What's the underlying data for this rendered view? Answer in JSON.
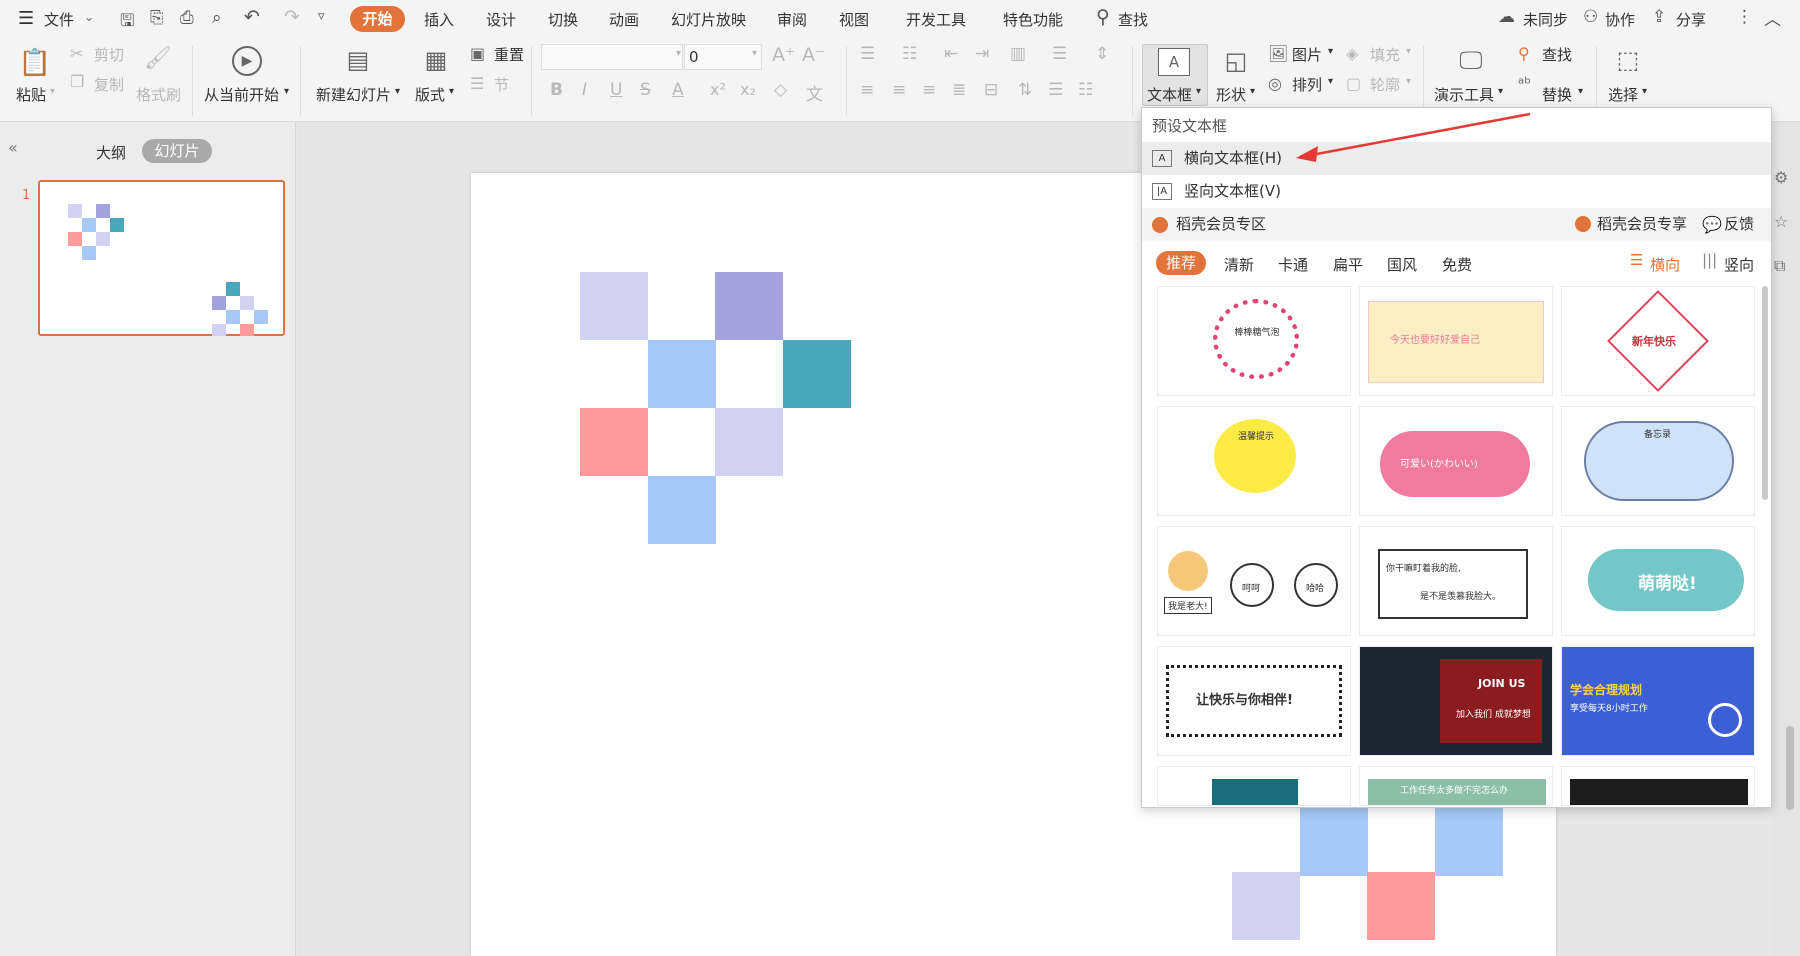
{
  "menubar": {
    "file": "文件",
    "tabs": [
      "开始",
      "插入",
      "设计",
      "切换",
      "动画",
      "幻灯片放映",
      "审阅",
      "视图",
      "开发工具",
      "特色功能"
    ],
    "search": "查找",
    "sync": "未同步",
    "collab": "协作",
    "share": "分享"
  },
  "ribbon": {
    "paste": "粘贴",
    "cut": "剪切",
    "copy": "复制",
    "format_painter": "格式刷",
    "play_from_current": "从当前开始",
    "new_slide": "新建幻灯片",
    "layout": "版式",
    "reset": "重置",
    "section": "节",
    "font_size": "0",
    "textbox": "文本框",
    "shape": "形状",
    "picture": "图片",
    "fill": "填充",
    "arrange": "排列",
    "outline": "轮廓",
    "presenter_tools": "演示工具",
    "find": "查找",
    "replace": "替换",
    "select": "选择"
  },
  "panel": {
    "outline_tab": "大纲",
    "slides_tab": "幻灯片",
    "slide_number": "1"
  },
  "dropdown": {
    "header": "预设文本框",
    "horizontal": "横向文本框(H)",
    "vertical": "竖向文本框(V)",
    "vip_zone": "稻壳会员专区",
    "vip_exclusive": "稻壳会员专享",
    "feedback": "反馈",
    "categories": [
      "推荐",
      "清新",
      "卡通",
      "扁平",
      "国风",
      "免费"
    ],
    "orient_h": "横向",
    "orient_v": "竖向",
    "templates": {
      "t1": "棒棒糖气泡",
      "t2": "今天也要好好爱自己",
      "t3": "新年快乐",
      "t4": "温馨提示",
      "t5": "可爱い(かわいい)",
      "t6": "备忘录",
      "t7a": "我是老大!",
      "t7b": "呵呵",
      "t7c": "哈哈",
      "t8a": "你干嘛盯着我的脸,",
      "t8b": "是不是羡慕我脸大。",
      "t9": "萌萌哒!",
      "t10": "让快乐与你相伴!",
      "t11a": "JOIN US",
      "t11b": "加入我们 成就梦想",
      "t12a": "学会合理规划",
      "t12b": "享受每天8小时工作",
      "t14": "工作任务太多做不完怎么办"
    }
  },
  "colors": {
    "accent": "#e2733a",
    "lavender": "#d2d1f1",
    "purple": "#a4a3de",
    "blue": "#a6c9f7",
    "teal": "#4aa6bb",
    "pink": "#fe9c9c",
    "red_arrow": "#e53935"
  }
}
